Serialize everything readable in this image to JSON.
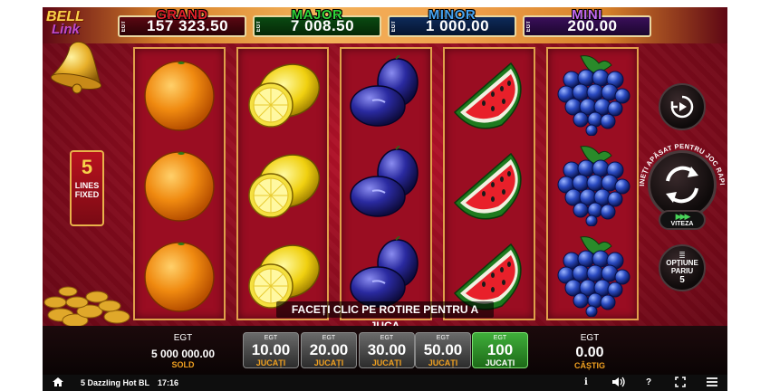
{
  "jackpots": [
    {
      "name": "GRAND",
      "amount": "157 323.50",
      "currency": "EGT"
    },
    {
      "name": "MAJOR",
      "amount": "7 008.50",
      "currency": "EGT"
    },
    {
      "name": "MINOR",
      "amount": "1 000.00",
      "currency": "EGT"
    },
    {
      "name": "MINI",
      "amount": "200.00",
      "currency": "EGT"
    }
  ],
  "logo": {
    "line1": "BELL",
    "line2": "Link"
  },
  "lines": {
    "count": "5",
    "label_line1": "LINES",
    "label_line2": "FIXED"
  },
  "reels": [
    [
      "orange-icon",
      "orange-icon",
      "orange-icon"
    ],
    [
      "lemon-icon",
      "lemon-icon",
      "lemon-icon"
    ],
    [
      "plum-icon",
      "plum-icon",
      "plum-icon"
    ],
    [
      "watermelon-icon",
      "watermelon-icon",
      "watermelon-icon"
    ],
    [
      "grapes-icon",
      "grapes-icon",
      "grapes-icon"
    ]
  ],
  "message": "FACEȚI CLIC PE ROTIRE PENTRU A JUCA",
  "controls": {
    "spin_ring_text": "ȚINEȚI APĂSAT PENTRU JOC RAPID",
    "speed_label": "VITEZA",
    "bet_options_label_line1": "OPȚIUNE",
    "bet_options_label_line2": "PARIU",
    "bet_options_value": "5"
  },
  "balance": {
    "currency": "EGT",
    "value": "5 000 000.00",
    "label": "SOLD"
  },
  "bets": [
    {
      "currency": "EGT",
      "value": "10.00",
      "label": "JUCAȚI",
      "selected": false
    },
    {
      "currency": "EGT",
      "value": "20.00",
      "label": "JUCAȚI",
      "selected": false
    },
    {
      "currency": "EGT",
      "value": "30.00",
      "label": "JUCAȚI",
      "selected": false
    },
    {
      "currency": "EGT",
      "value": "50.00",
      "label": "JUCAȚI",
      "selected": false
    },
    {
      "currency": "EGT",
      "value": "100",
      "label": "JUCAȚI",
      "selected": true
    }
  ],
  "win": {
    "currency": "EGT",
    "value": "0.00",
    "label": "CÂȘTIG"
  },
  "statusbar": {
    "game_name": "5 Dazzling Hot BL",
    "time": "17:16",
    "info_glyph": "i",
    "help_glyph": "?"
  },
  "colors": {
    "selected_bet": "#3fae3a",
    "label_accent": "#f0a020",
    "background": "#8c0c1f"
  }
}
